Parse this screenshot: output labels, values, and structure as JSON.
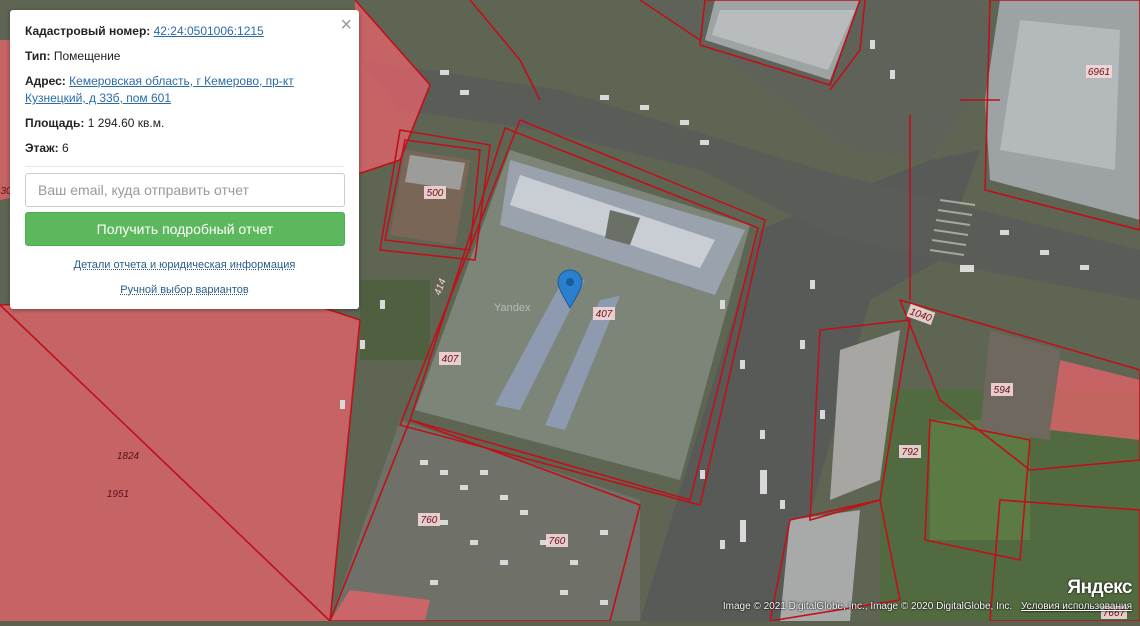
{
  "popup": {
    "cadastral_label": "Кадастровый номер:",
    "cadastral_value": "42:24:0501006:1215",
    "type_label": "Тип:",
    "type_value": "Помещение",
    "address_label": "Адрес:",
    "address_value": "Кемеровская область, г Кемерово, пр-кт Кузнецкий, д 33б, пом 601",
    "area_label": "Площадь:",
    "area_value": "1 294.60 кв.м.",
    "floor_label": "Этаж:",
    "floor_value": "6",
    "email_placeholder": "Ваш email, куда отправить отчет",
    "report_button": "Получить подробный отчет",
    "details_link": "Детали отчета и юридическая информация",
    "manual_link": "Ручной выбор вариантов",
    "close_glyph": "×"
  },
  "map": {
    "parcel_labels": [
      "500",
      "414",
      "407",
      "407",
      "760",
      "760",
      "1824",
      "1951",
      "1040",
      "594",
      "792",
      "6961",
      "7667",
      "30"
    ],
    "watermark": "Yandex",
    "logo": "Яндекс",
    "attribution": "Image © 2021 DigitalGlobe, Inc., Image © 2020 DigitalGlobe, Inc.",
    "terms_link": "Условия использования",
    "colors": {
      "parcel_line": "#c0101a",
      "parcel_fill": "#e8636b",
      "marker": "#2b7fcf",
      "button": "#5cb85c"
    }
  }
}
